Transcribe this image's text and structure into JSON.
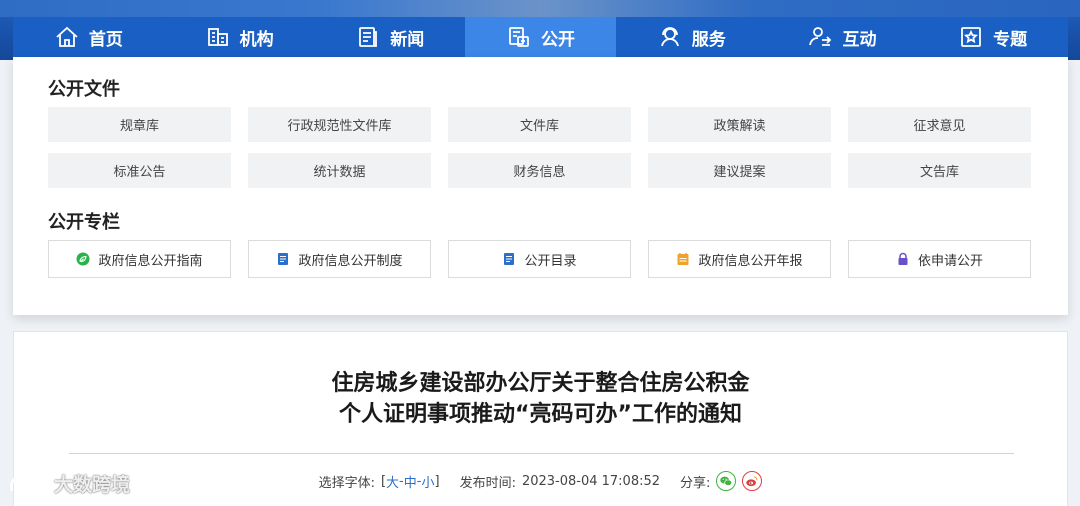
{
  "nav": {
    "items": [
      {
        "label": "首页",
        "icon": "home-icon"
      },
      {
        "label": "机构",
        "icon": "organization-icon"
      },
      {
        "label": "新闻",
        "icon": "news-icon"
      },
      {
        "label": "公开",
        "icon": "disclosure-icon",
        "active": true
      },
      {
        "label": "服务",
        "icon": "service-icon"
      },
      {
        "label": "互动",
        "icon": "interaction-icon"
      },
      {
        "label": "专题",
        "icon": "topic-icon"
      }
    ]
  },
  "panel": {
    "section1": {
      "title": "公开文件",
      "items": [
        "规章库",
        "行政规范性文件库",
        "文件库",
        "政策解读",
        "征求意见",
        "标准公告",
        "统计数据",
        "财务信息",
        "建议提案",
        "文告库"
      ]
    },
    "section2": {
      "title": "公开专栏",
      "items": [
        {
          "label": "政府信息公开指南",
          "icon": "leaf-icon",
          "color": "#2bb24c"
        },
        {
          "label": "政府信息公开制度",
          "icon": "document-icon",
          "color": "#2a6fc9"
        },
        {
          "label": "公开目录",
          "icon": "document-icon",
          "color": "#2a6fc9"
        },
        {
          "label": "政府信息公开年报",
          "icon": "calendar-icon",
          "color": "#f0a32a"
        },
        {
          "label": "依申请公开",
          "icon": "lock-icon",
          "color": "#6b4fc9"
        }
      ]
    }
  },
  "article": {
    "title_line1": "住房城乡建设部办公厅关于整合住房公积金",
    "title_line2": "个人证明事项推动“亮码可办”工作的通知",
    "font_label": "选择字体:",
    "font_open": "[",
    "font_large": "大",
    "font_medium": "中",
    "font_small": "小",
    "font_sep": " - ",
    "font_close": "]",
    "publish_label": "发布时间:",
    "publish_time": "2023-08-04 17:08:52",
    "share_label": "分享:",
    "share_wechat": "wechat-icon",
    "share_weibo": "weibo-icon"
  },
  "watermark": {
    "text": "大数跨境"
  },
  "colors": {
    "nav_bg": "#1a5fc4",
    "nav_active": "#3b86e6",
    "link": "#2a6fc9"
  }
}
